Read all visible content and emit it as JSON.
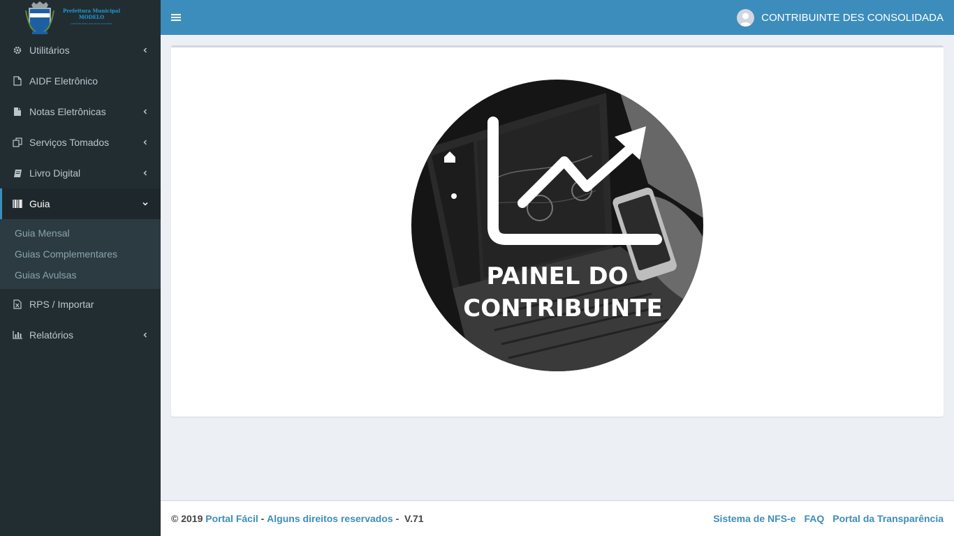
{
  "logo": {
    "line1": "Prefeitura Municipal",
    "line2": "MODELO",
    "line3": "CONSTRUINDO UMA NOVA HISTÓRIA"
  },
  "sidebar": {
    "items": [
      {
        "label": "Utilitários",
        "icon": "gear-icon"
      },
      {
        "label": "AIDF Eletrônico",
        "icon": "file-outline-icon"
      },
      {
        "label": "Notas Eletrônicas",
        "icon": "file-icon"
      },
      {
        "label": "Serviços Tomados",
        "icon": "copy-icon"
      },
      {
        "label": "Livro Digital",
        "icon": "book-icon"
      },
      {
        "label": "Guia",
        "icon": "barcode-icon"
      },
      {
        "label": "RPS / Importar",
        "icon": "excel-file-icon"
      },
      {
        "label": "Relatórios",
        "icon": "bar-chart-icon"
      }
    ],
    "guia_submenu": [
      "Guia Mensal",
      "Guias Complementares",
      "Guias Avulsas"
    ]
  },
  "header": {
    "user_name": "CONTRIBUINTE DES CONSOLIDADA"
  },
  "hero": {
    "line1": "PAINEL DO",
    "line2": "CONTRIBUINTE"
  },
  "footer": {
    "copyright": "© 2019",
    "brand": "Portal Fácil",
    "dash": "-",
    "rights": "Alguns direitos reservados",
    "version_sep": "-",
    "version": "V.71",
    "links": [
      "Sistema de NFS-e",
      "FAQ",
      "Portal da Transparência"
    ]
  },
  "colors": {
    "header": "#3c8dbc",
    "sidebar": "#222d32",
    "submenu": "#2c3b41",
    "link": "#3c8dbc"
  }
}
